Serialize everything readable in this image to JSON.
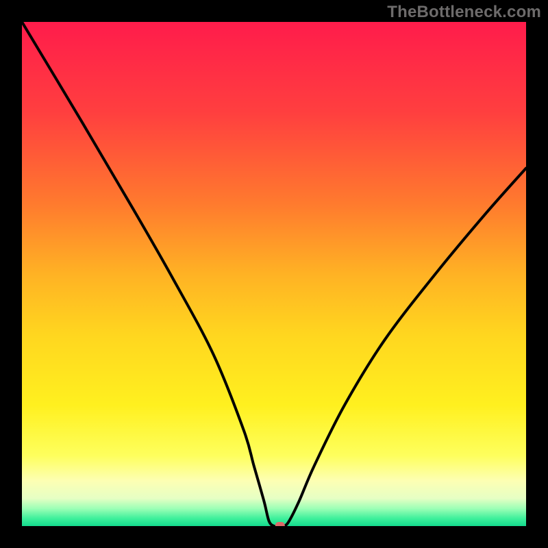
{
  "watermark": {
    "text": "TheBottleneck.com"
  },
  "chart_data": {
    "type": "line",
    "title": "",
    "xlabel": "",
    "ylabel": "",
    "xlim": [
      0,
      100
    ],
    "ylim": [
      0,
      100
    ],
    "series": [
      {
        "name": "bottleneck-curve",
        "x": [
          0,
          12,
          22,
          30,
          38,
          44,
          46,
          48,
          49,
          50,
          51,
          52,
          53,
          55,
          58,
          64,
          72,
          82,
          92,
          100
        ],
        "values": [
          100,
          80,
          63,
          49,
          34,
          19,
          12,
          5,
          1,
          0,
          0,
          0,
          1,
          5,
          12,
          24,
          37,
          50,
          62,
          71
        ]
      }
    ],
    "marker": {
      "x": 51.2,
      "y": 0,
      "color": "#dd6a6a"
    },
    "background": {
      "gradient_stops": [
        {
          "offset": 0.0,
          "color": "#ff1c4b"
        },
        {
          "offset": 0.18,
          "color": "#ff3f3f"
        },
        {
          "offset": 0.36,
          "color": "#ff7a2e"
        },
        {
          "offset": 0.5,
          "color": "#ffb224"
        },
        {
          "offset": 0.62,
          "color": "#ffd61f"
        },
        {
          "offset": 0.76,
          "color": "#fff01f"
        },
        {
          "offset": 0.86,
          "color": "#feff5d"
        },
        {
          "offset": 0.91,
          "color": "#fdffb3"
        },
        {
          "offset": 0.945,
          "color": "#e6ffc4"
        },
        {
          "offset": 0.965,
          "color": "#9dffb6"
        },
        {
          "offset": 0.985,
          "color": "#3df09b"
        },
        {
          "offset": 1.0,
          "color": "#14da8e"
        }
      ]
    }
  }
}
